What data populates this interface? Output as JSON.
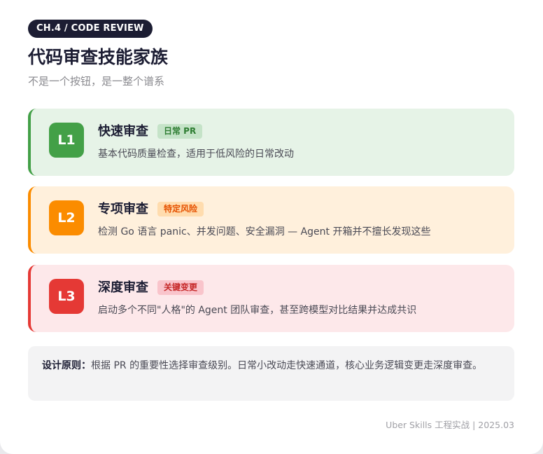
{
  "header": {
    "chapter_chip": "CH.4 / CODE REVIEW",
    "title": "代码审查技能家族",
    "subtitle": "不是一个按钮，是一整个谱系"
  },
  "levels": [
    {
      "badge": "L1",
      "name": "快速审查",
      "tag": "日常 PR",
      "description": "基本代码质量检查，适用于低风险的日常改动",
      "color": "#43a047"
    },
    {
      "badge": "L2",
      "name": "专项审查",
      "tag": "特定风险",
      "description": "检测 Go 语言 panic、并发问题、安全漏洞 — Agent 开箱并不擅长发现这些",
      "color": "#fb8c00"
    },
    {
      "badge": "L3",
      "name": "深度审查",
      "tag": "关键变更",
      "description": "启动多个不同\"人格\"的 Agent 团队审查，甚至跨模型对比结果并达成共识",
      "color": "#e53935"
    }
  ],
  "principle": {
    "label": "设计原则：",
    "text": "根据 PR 的重要性选择审查级别。日常小改动走快速通道，核心业务逻辑变更走深度审查。"
  },
  "footer": {
    "text": "Uber Skills 工程实战 | 2025.03"
  }
}
